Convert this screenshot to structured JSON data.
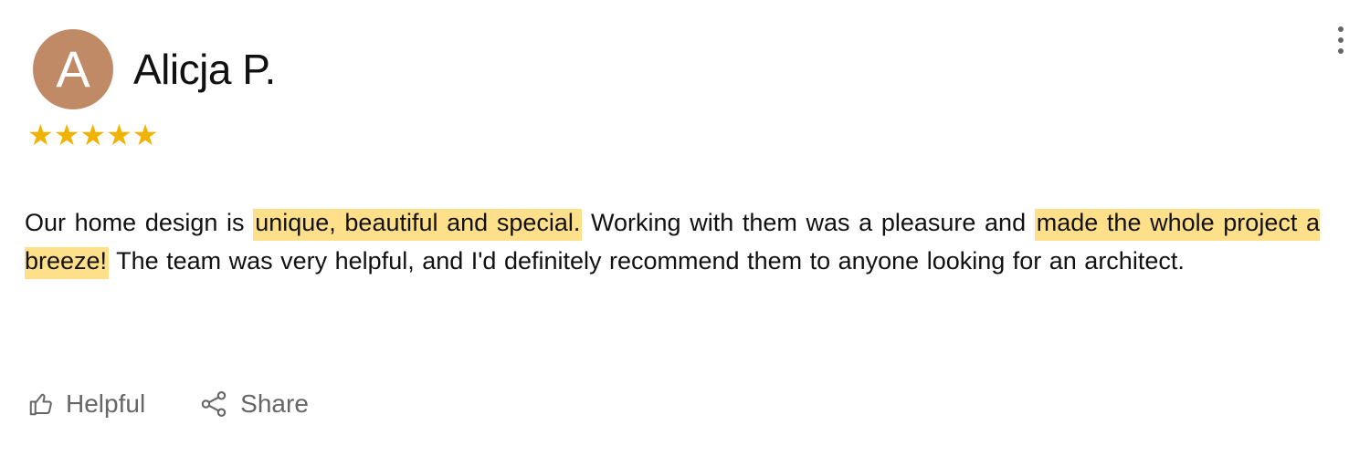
{
  "reviewer": {
    "avatar_letter": "A",
    "name": "Alicja P.",
    "avatar_color": "#c08a66"
  },
  "rating": {
    "stars": 5,
    "max": 5,
    "glyph": "★★★★★",
    "color": "#f0b400"
  },
  "review": {
    "segments": [
      {
        "text": "Our home design is ",
        "highlighted": false
      },
      {
        "text": "unique, beautiful and special.",
        "highlighted": true
      },
      {
        "text": " Working with them was a pleasure and ",
        "highlighted": false
      },
      {
        "text": "made the whole project a breeze!",
        "highlighted": true
      },
      {
        "text": " The team was very helpful, and I'd definitely recommend them to anyone looking for an architect.",
        "highlighted": false
      }
    ],
    "highlight_color": "#ffe08a"
  },
  "actions": {
    "helpful_label": "Helpful",
    "helpful_icon": "thumbs-up-icon",
    "share_label": "Share",
    "share_icon": "share-icon"
  },
  "menu": {
    "icon": "more-vertical-icon"
  }
}
